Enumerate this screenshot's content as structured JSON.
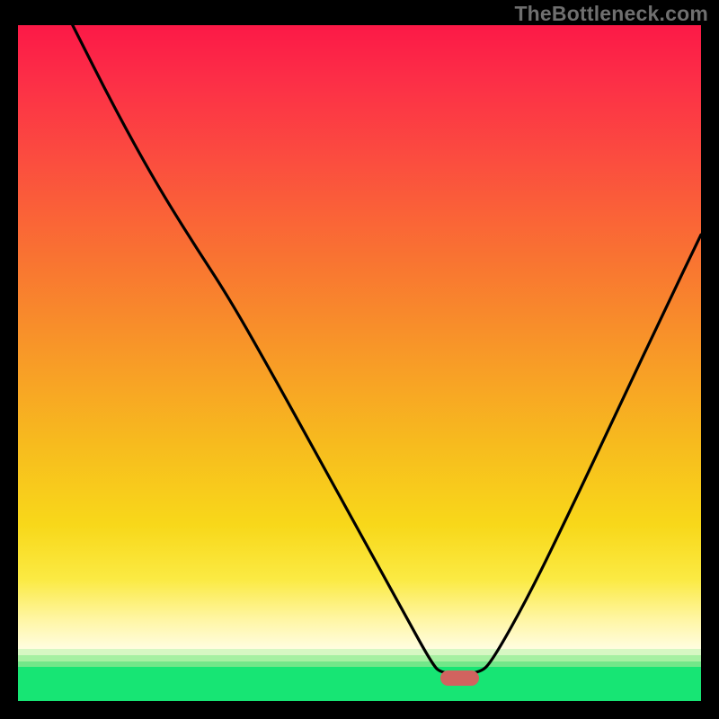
{
  "watermark": "TheBottleneck.com",
  "colors": {
    "frame_border": "#000000",
    "gradient_top": "#fc1947",
    "gradient_mid": "#f7bb1e",
    "gradient_pale": "#fffde0",
    "band_green_light": "#d7f7c3",
    "band_green_mid1": "#a6f0a2",
    "band_green_mid2": "#71e789",
    "band_green_saturated": "#17e574",
    "curve_stroke": "#000000",
    "marker_fill": "#d1635f",
    "watermark_text": "#6f6f6f"
  },
  "chart_data": {
    "type": "line",
    "title": "",
    "xlabel": "",
    "ylabel": "",
    "xlim": [
      0,
      100
    ],
    "ylim": [
      0,
      100
    ],
    "note": "x and y in percent of plot area; y=0 is top edge, y=100 is bottom (green) edge. Curve is a V-shaped bottleneck profile: steep descent from top-left, flat minimum around x≈62–67, then rises toward upper-right.",
    "series": [
      {
        "name": "bottleneck-curve",
        "points": [
          {
            "x": 8.0,
            "y": 0.0
          },
          {
            "x": 14.0,
            "y": 12.0
          },
          {
            "x": 20.0,
            "y": 23.0
          },
          {
            "x": 25.5,
            "y": 32.0
          },
          {
            "x": 31.0,
            "y": 40.5
          },
          {
            "x": 38.0,
            "y": 53.0
          },
          {
            "x": 44.0,
            "y": 64.0
          },
          {
            "x": 50.0,
            "y": 75.0
          },
          {
            "x": 56.0,
            "y": 86.0
          },
          {
            "x": 60.5,
            "y": 94.3
          },
          {
            "x": 62.0,
            "y": 96.0
          },
          {
            "x": 67.5,
            "y": 96.0
          },
          {
            "x": 69.5,
            "y": 94.0
          },
          {
            "x": 75.0,
            "y": 84.0
          },
          {
            "x": 81.0,
            "y": 71.5
          },
          {
            "x": 88.0,
            "y": 56.5
          },
          {
            "x": 95.0,
            "y": 41.5
          },
          {
            "x": 100.0,
            "y": 31.0
          }
        ]
      }
    ],
    "marker": {
      "name": "optimal-point",
      "x": 64.7,
      "y": 96.6,
      "width_pct": 5.6,
      "height_pct": 2.2
    }
  }
}
